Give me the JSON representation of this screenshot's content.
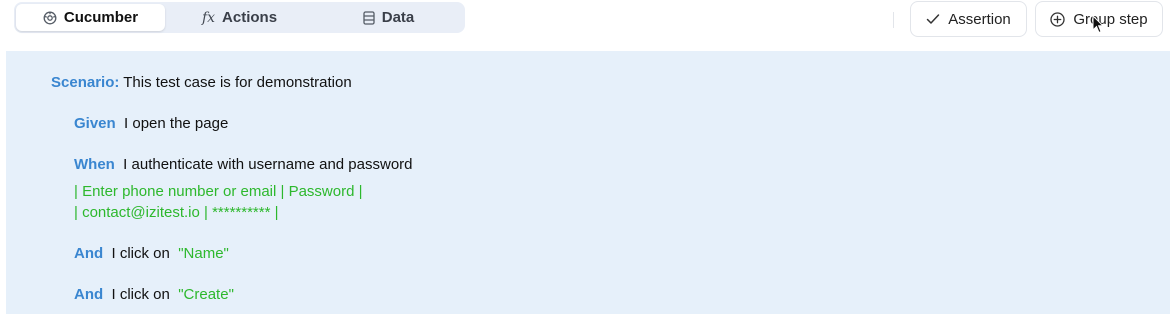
{
  "toolbar": {
    "tabs": [
      {
        "label": "Cucumber",
        "icon": "cucumber-icon",
        "active": true
      },
      {
        "label": "Actions",
        "icon": "fx-icon",
        "glyph": "fx",
        "active": false
      },
      {
        "label": "Data",
        "icon": "database-icon",
        "active": false
      }
    ],
    "buttons": {
      "assertion": {
        "label": "Assertion",
        "icon": "check-icon"
      },
      "group_step": {
        "label": "Group step",
        "icon": "plus-circle-icon"
      }
    }
  },
  "scenario": {
    "keyword": "Scenario:",
    "title": "This test case is for demonstration",
    "steps": [
      {
        "keyword": "Given",
        "text": "I open the page"
      },
      {
        "keyword": "When",
        "text": "I authenticate with username and password",
        "table": [
          "| Enter phone number or email | Password |",
          "| contact@izitest.io | ********** |"
        ]
      },
      {
        "keyword": "And",
        "text": "I click on",
        "argument": "\"Name\""
      },
      {
        "keyword": "And",
        "text": "I click on",
        "argument": "\"Create\""
      }
    ]
  },
  "colors": {
    "keyword": "#3a86d0",
    "string": "#2db82d",
    "panel_bg": "#e6f0fa",
    "tabs_bg": "#e9eef7"
  }
}
